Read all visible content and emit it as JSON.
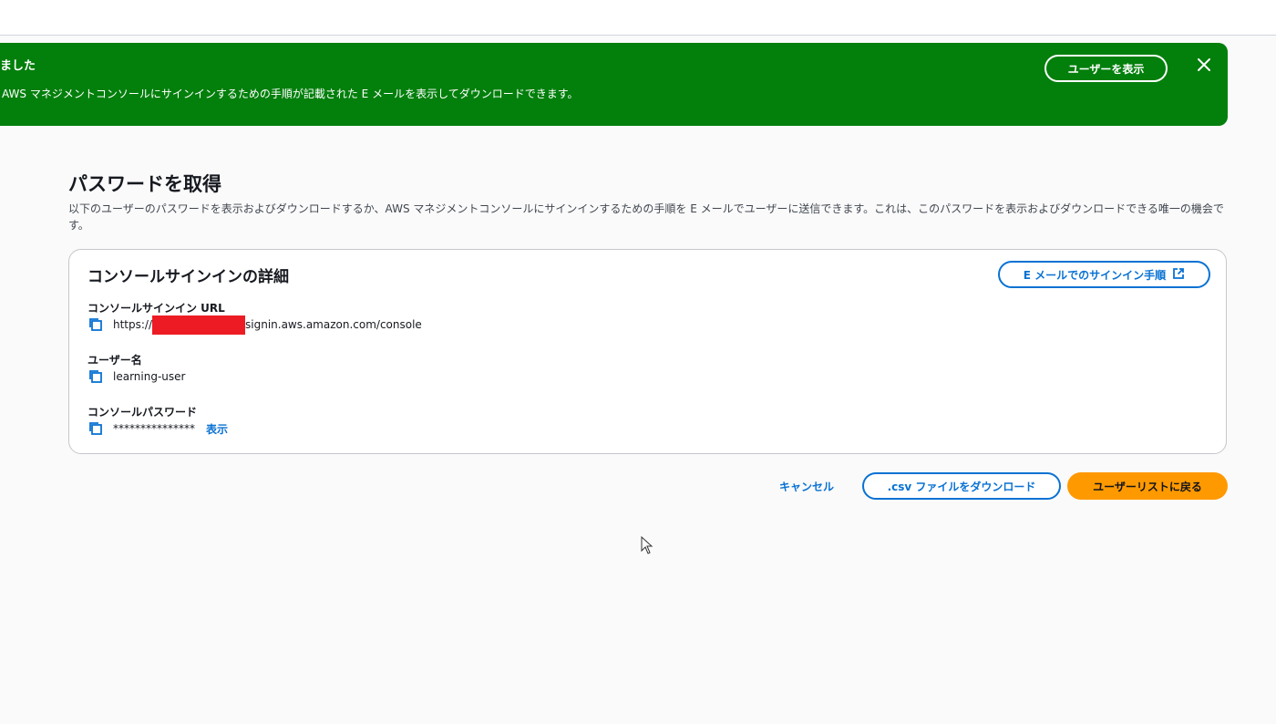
{
  "flash": {
    "title": "ました",
    "message": "AWS マネジメントコンソールにサインインするための手順が記載された E メールを表示してダウンロードできます。",
    "view_user_label": "ユーザーを表示",
    "close_icon": "close-icon",
    "background_color": "#037f0c"
  },
  "page": {
    "title": "パスワードを取得",
    "description": "以下のユーザーのパスワードを表示およびダウンロードするか、AWS マネジメントコンソールにサインインするための手順を E メールでユーザーに送信できます。これは、このパスワードを表示およびダウンロードできる唯一の機会です。"
  },
  "details": {
    "title": "コンソールサインインの詳細",
    "email_button_label": "E メールでのサインイン手順",
    "email_button_icon": "external-link-icon",
    "url_label": "コンソールサインイン URL",
    "url_prefix": "https://",
    "url_suffix": "signin.aws.amazon.com/console",
    "username_label": "ユーザー名",
    "username_value": "learning-user",
    "password_label": "コンソールパスワード",
    "password_value": "***************",
    "show_label": "表示",
    "copy_icon": "copy-icon"
  },
  "actions": {
    "cancel_label": "キャンセル",
    "csv_label": ".csv ファイルをダウンロード",
    "return_label": "ユーザーリストに戻る",
    "primary_color": "#ff9900",
    "link_color": "#0972d3"
  }
}
